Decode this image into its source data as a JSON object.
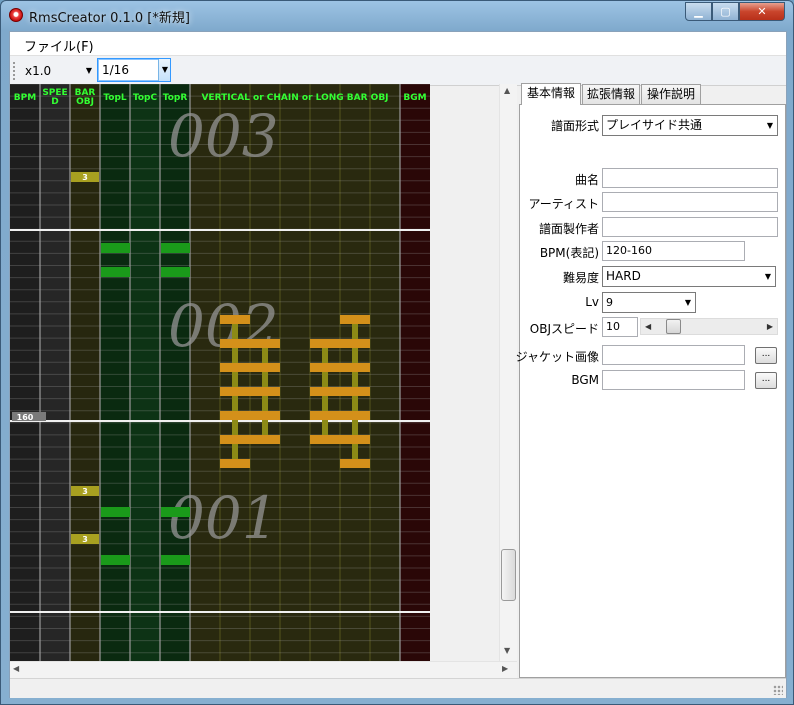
{
  "window": {
    "title": "RmsCreator 0.1.0 [*新規]",
    "min_glyph": "▁",
    "max_glyph": "▢",
    "close_glyph": "✕"
  },
  "menu": {
    "file": "ファイル(F)"
  },
  "toolbar": {
    "zoom": "x1.0",
    "division": "1/16"
  },
  "editor": {
    "columns": [
      "BPM",
      "SPEED",
      "BAR OBJ",
      "TopL",
      "TopC",
      "TopR",
      "VERTICAL or CHAIN or LONG BAR OBJ",
      "BGM"
    ],
    "column_header_lines": [
      [
        "BPM"
      ],
      [
        "SPEE",
        "D"
      ],
      [
        "BAR",
        "OBJ"
      ],
      [
        "TopL"
      ],
      [
        "TopC"
      ],
      [
        "TopR"
      ],
      [
        "VERTICAL or CHAIN or LONG BAR OBJ"
      ],
      [
        "BGM"
      ]
    ],
    "measures": [
      "003",
      "002",
      "001"
    ],
    "bpm_marker": "160",
    "bar_obj_labels": [
      "3",
      "3",
      "3"
    ]
  },
  "tabs": [
    "基本情報",
    "拡張情報",
    "操作説明"
  ],
  "form": {
    "chart_format_label": "譜面形式",
    "chart_format_value": "プレイサイド共通",
    "song_label": "曲名",
    "song_value": "",
    "artist_label": "アーティスト",
    "artist_value": "",
    "author_label": "譜面製作者",
    "author_value": "",
    "bpm_label": "BPM(表記)",
    "bpm_value": "120-160",
    "difficulty_label": "難易度",
    "difficulty_value": "HARD",
    "level_label": "Lv",
    "level_value": "9",
    "obj_speed_label": "OBJスピード",
    "obj_speed_value": "10",
    "jacket_label": "ジャケット画像",
    "jacket_value": "",
    "bgm_label": "BGM",
    "bgm_value": "",
    "browse_label": "..."
  },
  "colors": {
    "header_text": "#33ff33",
    "top_note": "#1a9a1a",
    "vertical_note": "#d4901a",
    "bar_label_bg": "#a8a020"
  }
}
